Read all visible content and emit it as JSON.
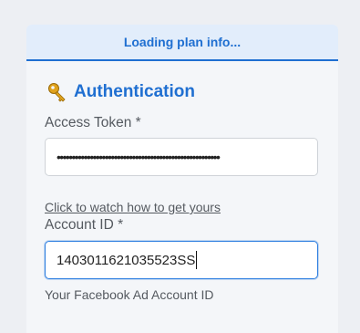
{
  "plan_bar": {
    "text": "Loading plan info..."
  },
  "auth": {
    "title": "Authentication",
    "icon": "key-icon"
  },
  "access_token": {
    "label": "Access Token *",
    "value_masked": "••••••••••••••••••••••••••••••••••••••••••••••••••••••"
  },
  "watch_link": {
    "text": "Click to watch how to get yours"
  },
  "account_id": {
    "label": "Account ID *",
    "value": "1403011621035523SS",
    "hint": "Your Facebook Ad Account ID"
  },
  "colors": {
    "accent": "#1f6fd1",
    "panel_bg": "#f4f6f9",
    "page_bg": "#edeff3"
  }
}
